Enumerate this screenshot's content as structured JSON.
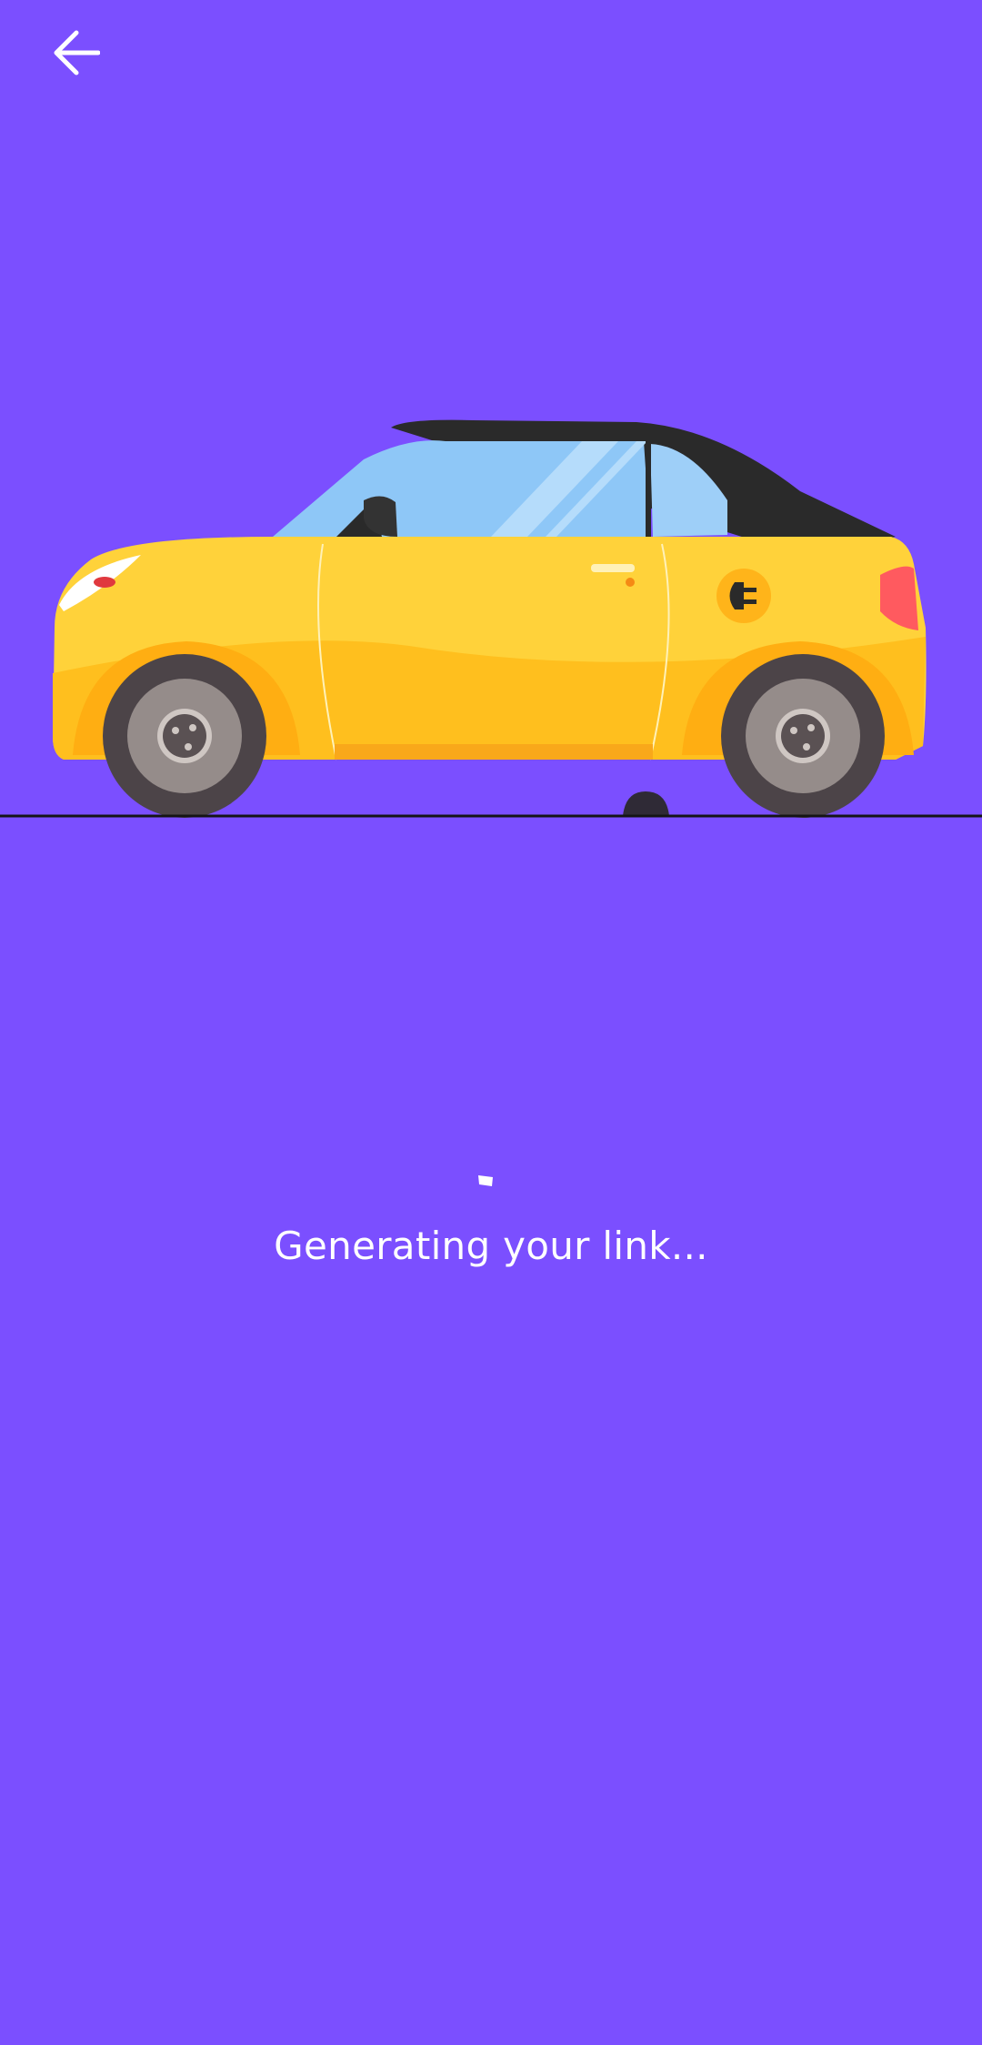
{
  "header": {
    "back_icon": "arrow-left-icon"
  },
  "illustration": {
    "subject": "yellow-electric-car",
    "colors": {
      "background": "#7B4FFF",
      "body": "#FFD23A",
      "body_shadow": "#FFAE12",
      "roof": "#2A2A2A",
      "window": "#8EC7F7",
      "tire": "#4C4448",
      "rim": "#958C8A"
    }
  },
  "loading": {
    "status_text": "Generating your link..."
  }
}
